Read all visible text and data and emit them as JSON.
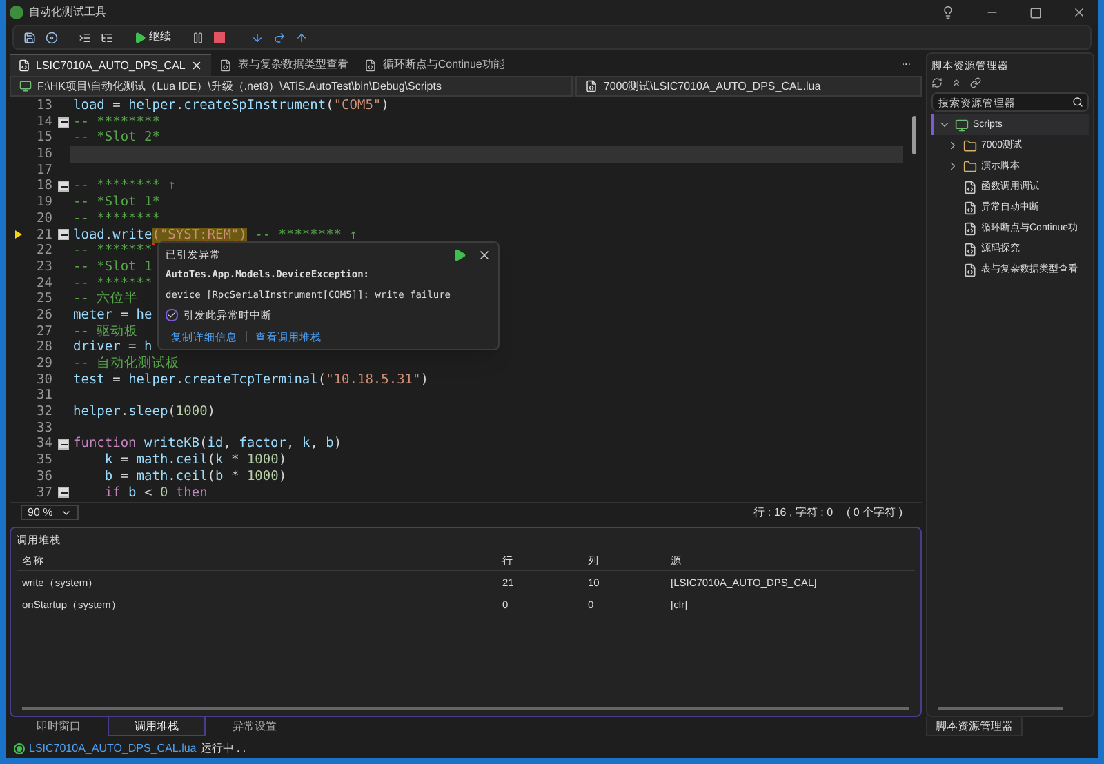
{
  "window": {
    "title": "自动化测试工具"
  },
  "toolbar": {
    "continue_label": "继续"
  },
  "doc_tabs": [
    {
      "label": "LSIC7010A_AUTO_DPS_CAL",
      "selected": true
    },
    {
      "label": "表与复杂数据类型查看",
      "selected": false
    },
    {
      "label": "循环断点与Continue功能",
      "selected": false
    }
  ],
  "path_bar": {
    "path": "F:\\HK项目\\自动化测试（Lua IDE）\\升级（.net8）\\ATiS.AutoTest\\bin\\Debug\\Scripts",
    "file": "7000测试\\LSIC7010A_AUTO_DPS_CAL.lua",
    "more": "..."
  },
  "editor": {
    "lines": [
      {
        "number": "13",
        "foldable": false,
        "current": false,
        "highlighted": false,
        "segments": [
          {
            "kind": "id",
            "text": "load"
          },
          {
            "kind": "plain",
            "text": " = "
          },
          {
            "kind": "id",
            "text": "helper"
          },
          {
            "kind": "plain",
            "text": "."
          },
          {
            "kind": "fn",
            "text": "createSpInstrument"
          },
          {
            "kind": "plain",
            "text": "("
          },
          {
            "kind": "str",
            "text": "\"COM5\""
          },
          {
            "kind": "plain",
            "text": ")"
          }
        ]
      },
      {
        "number": "14",
        "foldable": true,
        "current": false,
        "highlighted": false,
        "segments": [
          {
            "kind": "cmt",
            "text": "-- ********"
          }
        ]
      },
      {
        "number": "15",
        "foldable": false,
        "current": false,
        "highlighted": false,
        "segments": [
          {
            "kind": "cmt",
            "text": "-- *Slot 2*"
          }
        ]
      },
      {
        "number": "16",
        "foldable": false,
        "current": false,
        "highlighted": true
      },
      {
        "number": "17",
        "foldable": false,
        "current": false,
        "highlighted": false
      },
      {
        "number": "18",
        "foldable": true,
        "current": false,
        "highlighted": false,
        "segments": [
          {
            "kind": "cmt",
            "text": "-- ******** ↑"
          }
        ]
      },
      {
        "number": "19",
        "foldable": false,
        "current": false,
        "highlighted": false,
        "segments": [
          {
            "kind": "cmt",
            "text": "-- *Slot 1*"
          }
        ]
      },
      {
        "number": "20",
        "foldable": false,
        "current": false,
        "highlighted": false,
        "segments": [
          {
            "kind": "cmt",
            "text": "-- ********"
          }
        ]
      },
      {
        "number": "21",
        "foldable": true,
        "current": true,
        "highlighted": false,
        "segments": [
          {
            "kind": "id",
            "text": "load"
          },
          {
            "kind": "plain",
            "text": "."
          },
          {
            "kind": "fn",
            "text": "write"
          },
          {
            "kind": "error",
            "text": "(\"SYST:REM\")"
          },
          {
            "kind": "cmt",
            "text": " -- ******** ↑"
          }
        ]
      },
      {
        "number": "22",
        "foldable": false,
        "current": false,
        "highlighted": false,
        "segments": [
          {
            "kind": "cmt",
            "text": "-- *******"
          }
        ]
      },
      {
        "number": "23",
        "foldable": false,
        "current": false,
        "highlighted": false,
        "segments": [
          {
            "kind": "cmt",
            "text": "-- *Slot 1"
          }
        ]
      },
      {
        "number": "24",
        "foldable": false,
        "current": false,
        "highlighted": false,
        "segments": [
          {
            "kind": "cmt",
            "text": "-- *******"
          }
        ]
      },
      {
        "number": "25",
        "foldable": false,
        "current": false,
        "highlighted": false,
        "segments": [
          {
            "kind": "cmt",
            "text": "-- 六位半"
          }
        ]
      },
      {
        "number": "26",
        "foldable": false,
        "current": false,
        "highlighted": false,
        "segments": [
          {
            "kind": "id",
            "text": "meter"
          },
          {
            "kind": "plain",
            "text": " = "
          },
          {
            "kind": "id",
            "text": "he"
          }
        ]
      },
      {
        "number": "27",
        "foldable": false,
        "current": false,
        "highlighted": false,
        "segments": [
          {
            "kind": "cmt",
            "text": "-- 驱动板"
          }
        ]
      },
      {
        "number": "28",
        "foldable": false,
        "current": false,
        "highlighted": false,
        "segments": [
          {
            "kind": "id",
            "text": "driver"
          },
          {
            "kind": "plain",
            "text": " = "
          },
          {
            "kind": "id",
            "text": "h"
          }
        ]
      },
      {
        "number": "29",
        "foldable": false,
        "current": false,
        "highlighted": false,
        "segments": [
          {
            "kind": "cmt",
            "text": "-- 自动化测试板"
          }
        ]
      },
      {
        "number": "30",
        "foldable": false,
        "current": false,
        "highlighted": false,
        "segments": [
          {
            "kind": "id",
            "text": "test"
          },
          {
            "kind": "plain",
            "text": " = "
          },
          {
            "kind": "id",
            "text": "helper"
          },
          {
            "kind": "plain",
            "text": "."
          },
          {
            "kind": "fn",
            "text": "createTcpTerminal"
          },
          {
            "kind": "plain",
            "text": "("
          },
          {
            "kind": "str",
            "text": "\"10.18.5.31\""
          },
          {
            "kind": "plain",
            "text": ")"
          }
        ]
      },
      {
        "number": "31",
        "foldable": false,
        "current": false,
        "highlighted": false
      },
      {
        "number": "32",
        "foldable": false,
        "current": false,
        "highlighted": false,
        "segments": [
          {
            "kind": "id",
            "text": "helper"
          },
          {
            "kind": "plain",
            "text": "."
          },
          {
            "kind": "fn",
            "text": "sleep"
          },
          {
            "kind": "plain",
            "text": "("
          },
          {
            "kind": "num",
            "text": "1000"
          },
          {
            "kind": "plain",
            "text": ")"
          }
        ]
      },
      {
        "number": "33",
        "foldable": false,
        "current": false,
        "highlighted": false
      },
      {
        "number": "34",
        "foldable": true,
        "current": false,
        "highlighted": false,
        "segments": [
          {
            "kind": "kw",
            "text": "function"
          },
          {
            "kind": "fn",
            "text": " writeKB"
          },
          {
            "kind": "plain",
            "text": "("
          },
          {
            "kind": "id",
            "text": "id"
          },
          {
            "kind": "plain",
            "text": ", "
          },
          {
            "kind": "id",
            "text": "factor"
          },
          {
            "kind": "plain",
            "text": ", "
          },
          {
            "kind": "id",
            "text": "k"
          },
          {
            "kind": "plain",
            "text": ", "
          },
          {
            "kind": "id",
            "text": "b"
          },
          {
            "kind": "plain",
            "text": ")"
          }
        ]
      },
      {
        "number": "35",
        "foldable": false,
        "current": false,
        "highlighted": false,
        "segments": [
          {
            "kind": "id",
            "text": "    k"
          },
          {
            "kind": "plain",
            "text": " = "
          },
          {
            "kind": "id",
            "text": "math"
          },
          {
            "kind": "plain",
            "text": "."
          },
          {
            "kind": "fn",
            "text": "ceil"
          },
          {
            "kind": "plain",
            "text": "("
          },
          {
            "kind": "id",
            "text": "k"
          },
          {
            "kind": "plain",
            "text": " * "
          },
          {
            "kind": "num",
            "text": "1000"
          },
          {
            "kind": "plain",
            "text": ")"
          }
        ]
      },
      {
        "number": "36",
        "foldable": false,
        "current": false,
        "highlighted": false,
        "segments": [
          {
            "kind": "id",
            "text": "    b"
          },
          {
            "kind": "plain",
            "text": " = "
          },
          {
            "kind": "id",
            "text": "math"
          },
          {
            "kind": "plain",
            "text": "."
          },
          {
            "kind": "fn",
            "text": "ceil"
          },
          {
            "kind": "plain",
            "text": "("
          },
          {
            "kind": "id",
            "text": "b"
          },
          {
            "kind": "plain",
            "text": " * "
          },
          {
            "kind": "num",
            "text": "1000"
          },
          {
            "kind": "plain",
            "text": ")"
          }
        ]
      },
      {
        "number": "37",
        "foldable": true,
        "current": false,
        "highlighted": false,
        "segments": [
          {
            "kind": "kw",
            "text": "    if"
          },
          {
            "kind": "id",
            "text": " b"
          },
          {
            "kind": "plain",
            "text": " < "
          },
          {
            "kind": "num",
            "text": "0"
          },
          {
            "kind": "kw",
            "text": " then"
          }
        ]
      }
    ],
    "zoom": "90 %",
    "position": "行 : 16 , 字符 : 0",
    "selection": "( 0 个字符 )"
  },
  "exception_popup": {
    "title": "已引发异常",
    "type": "AutoTes.App.Models.DeviceException:",
    "message": "device [RpcSerialInstrument[COM5]]: write failure",
    "break_option": {
      "label": "引发此异常时中断",
      "checked": true
    },
    "links": [
      "复制详细信息",
      "查看调用堆栈"
    ]
  },
  "call_stack": {
    "title": "调用堆栈",
    "columns": [
      "名称",
      "行",
      "列",
      "源"
    ],
    "rows": [
      [
        "write（system）",
        "21",
        "10",
        "[LSIC7010A_AUTO_DPS_CAL]"
      ],
      [
        "onStartup（system）",
        "0",
        "0",
        "[clr]"
      ]
    ]
  },
  "bottom_tabs": [
    {
      "label": "即时窗口",
      "selected": false
    },
    {
      "label": "调用堆栈",
      "selected": true
    },
    {
      "label": "异常设置",
      "selected": false
    }
  ],
  "explorer": {
    "title": "脚本资源管理器",
    "search": {
      "placeholder": "搜索资源管理器"
    },
    "tree": [
      {
        "label": "Scripts",
        "kind": "root",
        "expanded": true,
        "children": [
          {
            "label": "7000测试",
            "kind": "folder",
            "expanded": false
          },
          {
            "label": "演示脚本",
            "kind": "folder",
            "expanded": false
          },
          {
            "label": "函数调用调试",
            "kind": "file"
          },
          {
            "label": "异常自动中断",
            "kind": "file"
          },
          {
            "label": "循环断点与Continue功",
            "kind": "file"
          },
          {
            "label": "源码探究",
            "kind": "file"
          },
          {
            "label": "表与复杂数据类型查看",
            "kind": "file"
          }
        ]
      }
    ],
    "tab": "脚本资源管理器"
  },
  "status_bar": {
    "file": "LSIC7010A_AUTO_DPS_CAL.lua",
    "state": "运行中 . ."
  }
}
